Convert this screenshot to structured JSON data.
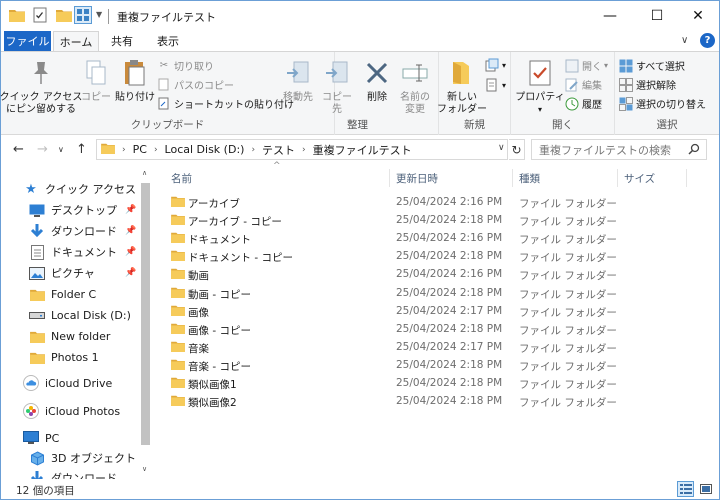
{
  "window": {
    "title": "重複ファイルテスト",
    "controls": {
      "minimize": "—",
      "maximize": "☐",
      "close": "✕"
    }
  },
  "tabs": {
    "file": "ファイル",
    "home": "ホーム",
    "share": "共有",
    "view": "表示"
  },
  "ribbon": {
    "clipboard": {
      "label": "クリップボード",
      "pin": "クイック アクセス\nにピン留めする",
      "copy": "コピー",
      "paste": "貼り付け",
      "cut": "切り取り",
      "copy_path": "パスのコピー",
      "paste_shortcut": "ショートカットの貼り付け"
    },
    "organize": {
      "label": "整理",
      "move_to": "移動先",
      "copy_to": "コピー先",
      "delete": "削除",
      "rename": "名前の\n変更"
    },
    "new": {
      "label": "新規",
      "new_folder": "新しい\nフォルダー"
    },
    "open": {
      "label": "開く",
      "properties": "プロパティ",
      "open": "開く",
      "edit": "編集",
      "history": "履歴"
    },
    "select": {
      "label": "選択",
      "select_all": "すべて選択",
      "select_none": "選択解除",
      "invert": "選択の切り替え"
    }
  },
  "address": {
    "path": [
      "PC",
      "Local Disk (D:)",
      "テスト",
      "重複ファイルテスト"
    ],
    "search_placeholder": "重複ファイルテストの検索"
  },
  "navpane": {
    "quick_access": "クイック アクセス",
    "items": [
      {
        "label": "デスクトップ",
        "icon": "desktop-icon",
        "pinned": true
      },
      {
        "label": "ダウンロード",
        "icon": "download-icon",
        "pinned": true
      },
      {
        "label": "ドキュメント",
        "icon": "document-icon",
        "pinned": true
      },
      {
        "label": "ピクチャ",
        "icon": "pictures-icon",
        "pinned": true
      },
      {
        "label": "Folder C",
        "icon": "folder-icon",
        "pinned": false
      },
      {
        "label": "Local Disk (D:)",
        "icon": "drive-icon",
        "pinned": false
      },
      {
        "label": "New folder",
        "icon": "folder-icon",
        "pinned": false
      },
      {
        "label": "Photos 1",
        "icon": "folder-icon",
        "pinned": false
      }
    ],
    "icloud_drive": "iCloud Drive",
    "icloud_photos": "iCloud Photos",
    "pc": "PC",
    "objects3d": "3D オブジェクト",
    "downloads_partial": "ダウンロード"
  },
  "columns": {
    "name": "名前",
    "date": "更新日時",
    "type": "種類",
    "size": "サイズ"
  },
  "files": [
    {
      "name": "アーカイブ",
      "date": "25/04/2024 2:16 PM",
      "type": "ファイル フォルダー"
    },
    {
      "name": "アーカイブ - コピー",
      "date": "25/04/2024 2:18 PM",
      "type": "ファイル フォルダー"
    },
    {
      "name": "ドキュメント",
      "date": "25/04/2024 2:16 PM",
      "type": "ファイル フォルダー"
    },
    {
      "name": "ドキュメント - コピー",
      "date": "25/04/2024 2:18 PM",
      "type": "ファイル フォルダー"
    },
    {
      "name": "動画",
      "date": "25/04/2024 2:16 PM",
      "type": "ファイル フォルダー"
    },
    {
      "name": "動画 - コピー",
      "date": "25/04/2024 2:18 PM",
      "type": "ファイル フォルダー"
    },
    {
      "name": "画像",
      "date": "25/04/2024 2:17 PM",
      "type": "ファイル フォルダー"
    },
    {
      "name": "画像 - コピー",
      "date": "25/04/2024 2:18 PM",
      "type": "ファイル フォルダー"
    },
    {
      "name": "音楽",
      "date": "25/04/2024 2:17 PM",
      "type": "ファイル フォルダー"
    },
    {
      "name": "音楽 - コピー",
      "date": "25/04/2024 2:18 PM",
      "type": "ファイル フォルダー"
    },
    {
      "name": "類似画像1",
      "date": "25/04/2024 2:18 PM",
      "type": "ファイル フォルダー"
    },
    {
      "name": "類似画像2",
      "date": "25/04/2024 2:18 PM",
      "type": "ファイル フォルダー"
    }
  ],
  "status": {
    "count": "12 個の項目"
  },
  "colors": {
    "accent": "#1c67c7",
    "folder": "#f6cb5a",
    "folder_dark": "#e0a93a"
  }
}
